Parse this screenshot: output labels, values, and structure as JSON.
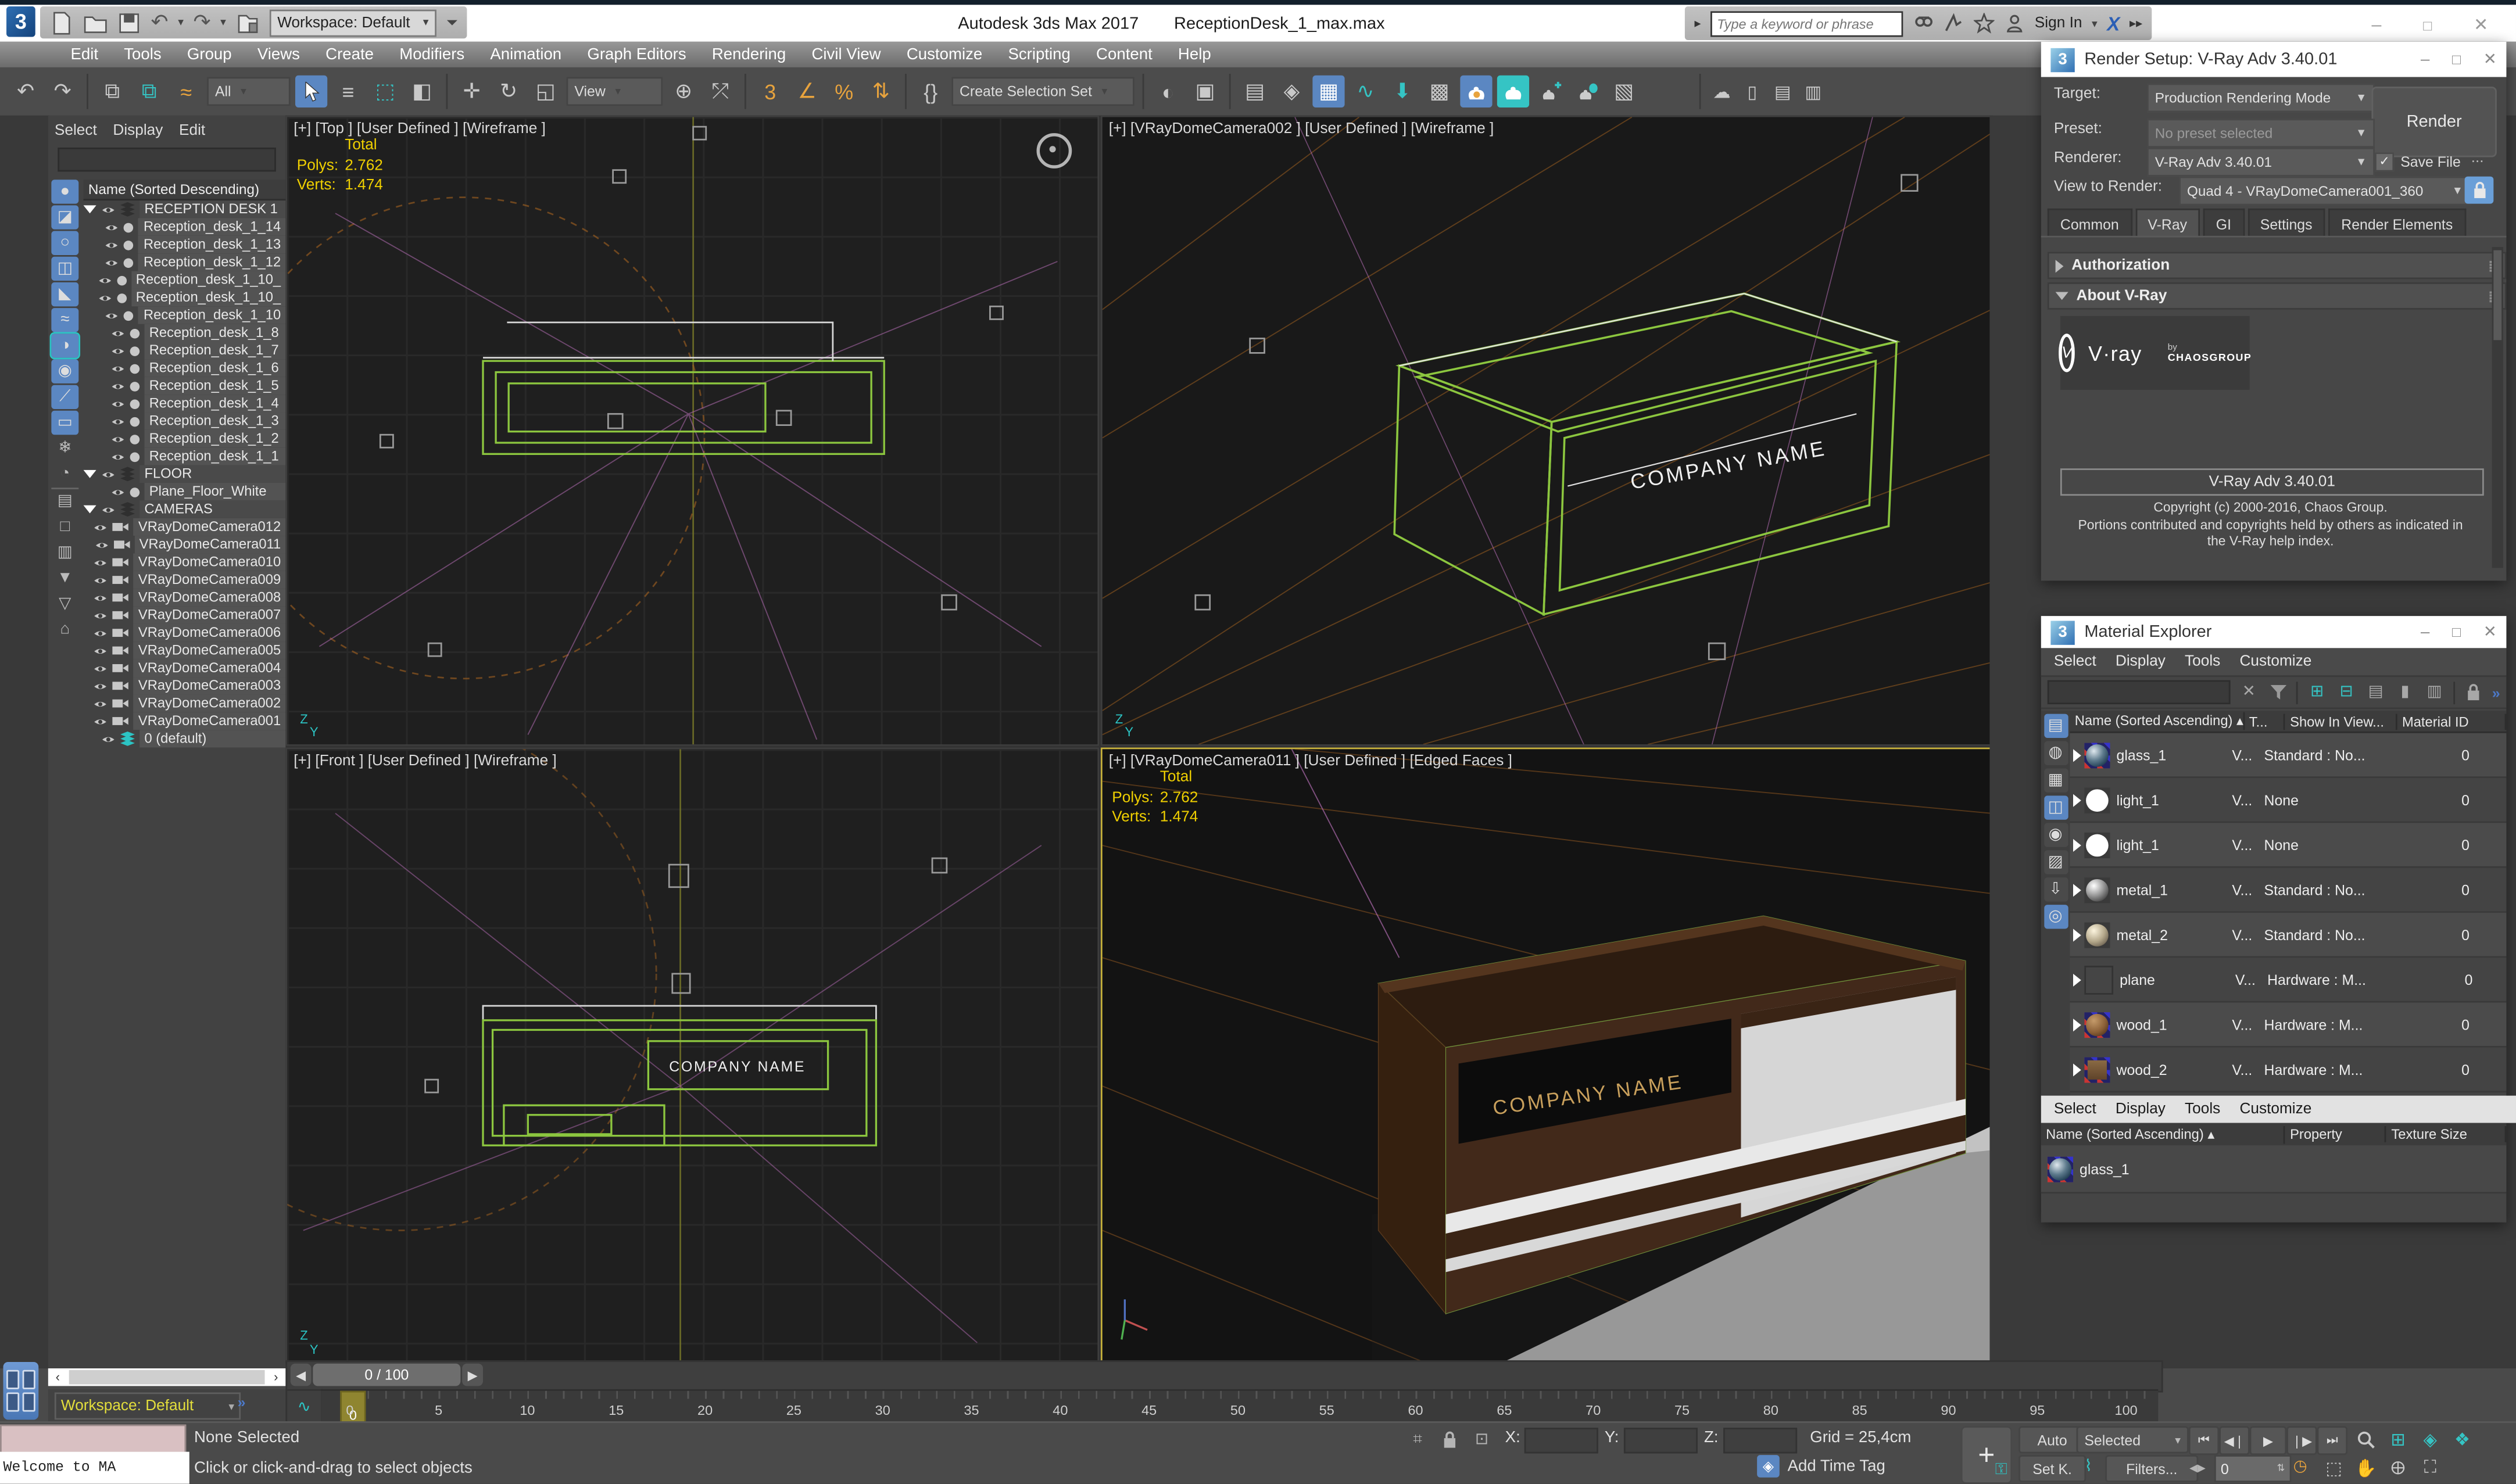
{
  "window": {
    "app_title": "Autodesk 3ds Max 2017",
    "file_title": "ReceptionDesk_1_max.max",
    "minimize": "–",
    "maximize": "❒",
    "close": "✕"
  },
  "qat": {
    "workspace": "Workspace: Default"
  },
  "search": {
    "placeholder": "Type a keyword or phrase",
    "signin": "Sign In"
  },
  "menubar": {
    "items": [
      "Edit",
      "Tools",
      "Group",
      "Views",
      "Create",
      "Modifiers",
      "Animation",
      "Graph Editors",
      "Rendering",
      "Civil View",
      "Customize",
      "Scripting",
      "Content",
      "Help"
    ]
  },
  "toolbar": {
    "filter_all": "All",
    "ref_coord": "View",
    "selection_set": "Create Selection Set"
  },
  "scene_explorer": {
    "menus": [
      "Select",
      "Display",
      "Edit"
    ],
    "header": "Name (Sorted Descending)",
    "rows": [
      {
        "kind": "group",
        "label": "RECEPTION DESK 1"
      },
      {
        "kind": "object",
        "label": "Reception_desk_1_14"
      },
      {
        "kind": "object",
        "label": "Reception_desk_1_13"
      },
      {
        "kind": "object",
        "label": "Reception_desk_1_12"
      },
      {
        "kind": "object",
        "label": "Reception_desk_1_10_"
      },
      {
        "kind": "object",
        "label": "Reception_desk_1_10_"
      },
      {
        "kind": "object",
        "label": "Reception_desk_1_10"
      },
      {
        "kind": "object",
        "label": "Reception_desk_1_8"
      },
      {
        "kind": "object",
        "label": "Reception_desk_1_7"
      },
      {
        "kind": "object",
        "label": "Reception_desk_1_6"
      },
      {
        "kind": "object",
        "label": "Reception_desk_1_5"
      },
      {
        "kind": "object",
        "label": "Reception_desk_1_4"
      },
      {
        "kind": "object",
        "label": "Reception_desk_1_3"
      },
      {
        "kind": "object",
        "label": "Reception_desk_1_2"
      },
      {
        "kind": "object",
        "label": "Reception_desk_1_1"
      },
      {
        "kind": "group",
        "label": "FLOOR"
      },
      {
        "kind": "object",
        "label": "Plane_Floor_White"
      },
      {
        "kind": "group",
        "label": "CAMERAS"
      },
      {
        "kind": "camera",
        "label": "VRayDomeCamera012"
      },
      {
        "kind": "camera",
        "label": "VRayDomeCamera011"
      },
      {
        "kind": "camera",
        "label": "VRayDomeCamera010"
      },
      {
        "kind": "camera",
        "label": "VRayDomeCamera009"
      },
      {
        "kind": "camera",
        "label": "VRayDomeCamera008"
      },
      {
        "kind": "camera",
        "label": "VRayDomeCamera007"
      },
      {
        "kind": "camera",
        "label": "VRayDomeCamera006"
      },
      {
        "kind": "camera",
        "label": "VRayDomeCamera005"
      },
      {
        "kind": "camera",
        "label": "VRayDomeCamera004"
      },
      {
        "kind": "camera",
        "label": "VRayDomeCamera003"
      },
      {
        "kind": "camera",
        "label": "VRayDomeCamera002"
      },
      {
        "kind": "camera",
        "label": "VRayDomeCamera001"
      },
      {
        "kind": "layer",
        "label": "0 (default)"
      }
    ],
    "workspace_status": "Workspace: Default"
  },
  "viewports": {
    "tl": {
      "label": "[+] [Top ]  [User Defined ]  [Wireframe ]",
      "stats_total": "Total",
      "polys_label": "Polys:",
      "polys": "2.762",
      "verts_label": "Verts:",
      "verts": "1.474"
    },
    "tr": {
      "label": "[+] [VRayDomeCamera002 ]  [User Defined ]  [Wireframe ]",
      "company": "COMPANY NAME"
    },
    "bl": {
      "label": "[+] [Front ]  [User Defined ]  [Wireframe ]",
      "company": "COMPANY NAME"
    },
    "br": {
      "label": "[+] [VRayDomeCamera011 ]  [User Defined ]  [Edged Faces ]",
      "stats_total": "Total",
      "polys_label": "Polys:",
      "polys": "2.762",
      "verts_label": "Verts:",
      "verts": "1.474",
      "company": "COMPANY NAME"
    }
  },
  "render_setup": {
    "title": "Render Setup: V-Ray Adv 3.40.01",
    "target_label": "Target:",
    "target_value": "Production Rendering Mode",
    "preset_label": "Preset:",
    "preset_value": "No preset selected",
    "renderer_label": "Renderer:",
    "renderer_value": "V-Ray Adv 3.40.01",
    "save_file": "Save File",
    "ellipsis": "...",
    "view_label": "View to Render:",
    "view_value": "Quad 4 - VRayDomeCamera001_360",
    "render_button": "Render",
    "tabs": [
      "Common",
      "V-Ray",
      "GI",
      "Settings",
      "Render Elements"
    ],
    "active_tab": "V-Ray",
    "rollout_auth": "Authorization",
    "rollout_about": "About V-Ray",
    "logo_vray": "V·ray",
    "logo_by": "by",
    "logo_chaos": "CHAOSGROUP",
    "version": "V-Ray Adv 3.40.01",
    "copyright1": "Copyright (c) 2000-2016, Chaos Group.",
    "copyright2": "Portions contributed and copyrights held by others as indicated in",
    "copyright3": "the V-Ray help index."
  },
  "material_explorer": {
    "title": "Material Explorer",
    "menus": [
      "Select",
      "Display",
      "Tools",
      "Customize"
    ],
    "columns": [
      "Name (Sorted Ascending)",
      "T...",
      "Show In View...",
      "Material ID"
    ],
    "rows": [
      {
        "name": "glass_1",
        "type": "V...",
        "show": "Standard : No...",
        "id": "0",
        "thumb": "glass"
      },
      {
        "name": "light_1",
        "type": "V...",
        "show": "None",
        "id": "0",
        "thumb": "light"
      },
      {
        "name": "light_1",
        "type": "V...",
        "show": "None",
        "id": "0",
        "thumb": "light"
      },
      {
        "name": "metal_1",
        "type": "V...",
        "show": "Standard : No...",
        "id": "0",
        "thumb": "metal1"
      },
      {
        "name": "metal_2",
        "type": "V...",
        "show": "Standard : No...",
        "id": "0",
        "thumb": "metal2"
      },
      {
        "name": "plane",
        "type": "V...",
        "show": "Hardware : M...",
        "id": "0",
        "thumb": "plane"
      },
      {
        "name": "wood_1",
        "type": "V...",
        "show": "Hardware : M...",
        "id": "0",
        "thumb": "wood1"
      },
      {
        "name": "wood_2",
        "type": "V...",
        "show": "Hardware : M...",
        "id": "0",
        "thumb": "wood2"
      }
    ],
    "bottom_menus": [
      "Select",
      "Display",
      "Tools",
      "Customize"
    ],
    "bottom_columns": [
      "Name (Sorted Ascending)",
      "Property",
      "Texture Size"
    ],
    "bottom_row_name": "glass_1"
  },
  "timeline": {
    "slider": "0 / 100",
    "marker": "0",
    "ticks": [
      "0",
      "5",
      "10",
      "15",
      "20",
      "25",
      "30",
      "35",
      "40",
      "45",
      "50",
      "55",
      "60",
      "65",
      "70",
      "75",
      "80",
      "85",
      "90",
      "95",
      "100"
    ]
  },
  "statusbar": {
    "welcome": "Welcome to MA",
    "none_selected": "None Selected",
    "prompt": "Click or click-and-drag to select objects",
    "x_label": "X:",
    "y_label": "Y:",
    "z_label": "Z:",
    "grid": "Grid = 25,4cm",
    "add_time_tag": "Add Time Tag",
    "auto": "Auto",
    "selected": "Selected",
    "set_k": "Set K.",
    "filters": "Filters...",
    "frame": "0"
  },
  "colors": {
    "accent_blue": "#5b87c2",
    "teal": "#2cc4c4",
    "active_border": "#c8b23c",
    "wire_green": "#8cc63f",
    "grid_orange": "#a5631f",
    "stats_yellow": "#f0d000",
    "workspace_yellow": "#e3de3c",
    "titlebar": "#ffffff"
  }
}
